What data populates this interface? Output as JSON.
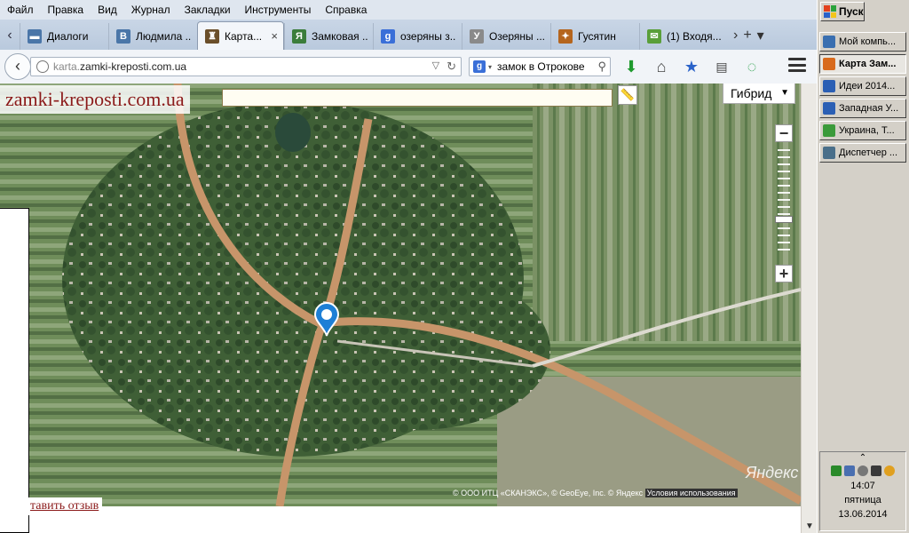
{
  "menu": [
    "Файл",
    "Правка",
    "Вид",
    "Журнал",
    "Закладки",
    "Инструменты",
    "Справка"
  ],
  "window_controls": {
    "minimize": "_",
    "maximize": "□",
    "close": "✕"
  },
  "tabs": [
    {
      "label": "Диалоги",
      "icon": "chat-icon",
      "color": "#4a76a8",
      "glyph": "▬"
    },
    {
      "label": "Людмила ...",
      "icon": "vk-icon",
      "color": "#4a76a8",
      "glyph": "В"
    },
    {
      "label": "Карта...",
      "icon": "castle-icon",
      "color": "#6b4f2a",
      "glyph": "♜",
      "active": true
    },
    {
      "label": "Замковая ...",
      "icon": "landmark-icon",
      "color": "#3b7d3b",
      "glyph": "Я"
    },
    {
      "label": "озеряны з...",
      "icon": "google-icon",
      "color": "#3a6fd8",
      "glyph": "g"
    },
    {
      "label": "Озеряны ...",
      "icon": "yandex-icon",
      "color": "#8a8a8a",
      "glyph": "У"
    },
    {
      "label": "Гусятин",
      "icon": "coat-of-arms-icon",
      "color": "#b5651d",
      "glyph": "✦"
    },
    {
      "label": "(1) Входя...",
      "icon": "mail-icon",
      "color": "#5a9f3a",
      "glyph": "✉"
    }
  ],
  "tab_close": "×",
  "tab_tools": {
    "scroll": "›",
    "new_tab": "+",
    "list": "▾"
  },
  "nav": {
    "back": "‹",
    "url_prefix": "karta.",
    "url_domain": "zamki-kreposti.com.ua",
    "search_engine": "g",
    "search_value": "замок в Отрокове"
  },
  "map": {
    "site_logo": "zamki-kreposti.com.ua",
    "type_selector": "Гибрид",
    "zoom_in": "+",
    "zoom_out": "−",
    "yandex_logo": "Яндекс",
    "copyright": "© ООО ИТЦ «СКАНЭКС», © GeoEye, Inc. © Яндекс",
    "terms": "Условия использования",
    "review_link": "тавить отзыв",
    "zoom_level_fraction": 0.35
  },
  "taskbar": {
    "start": "Пуск",
    "tasks": [
      {
        "label": "Мой компь...",
        "icon": "computer-icon",
        "color": "#3a6fb0"
      },
      {
        "label": "Карта Зам...",
        "icon": "firefox-icon",
        "color": "#d86a1c",
        "active": true
      },
      {
        "label": "Идеи 2014...",
        "icon": "word-icon",
        "color": "#2b5fb4"
      },
      {
        "label": "Западная У...",
        "icon": "word-icon",
        "color": "#2b5fb4"
      },
      {
        "label": "Украина, Т...",
        "icon": "chrome-icon",
        "color": "#3a9a3a"
      },
      {
        "label": "Диспетчер ...",
        "icon": "task-manager-icon",
        "color": "#4a6f8a"
      }
    ],
    "tray": {
      "up_arrow": "⌃",
      "time": "14:07",
      "day": "пятница",
      "date": "13.06.2014"
    }
  }
}
